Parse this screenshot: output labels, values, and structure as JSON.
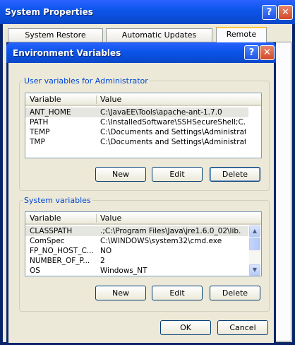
{
  "outer_window": {
    "title": "System Properties",
    "help_label": "?",
    "close_label": "✕",
    "tabs": [
      {
        "label": "System Restore"
      },
      {
        "label": "Automatic Updates"
      },
      {
        "label": "Remote"
      }
    ]
  },
  "dialog": {
    "title": "Environment Variables",
    "help_label": "?",
    "close_label": "✕",
    "user_group": {
      "label": "User variables for Administrator",
      "columns": [
        "Variable",
        "Value"
      ],
      "rows": [
        {
          "variable": "ANT_HOME",
          "value": "C:\\JavaEE\\Tools\\apache-ant-1.7.0",
          "selected": true
        },
        {
          "variable": "PATH",
          "value": "C:\\InstalledSoftware\\SSHSecureShell;C...",
          "selected": false
        },
        {
          "variable": "TEMP",
          "value": "C:\\Documents and Settings\\Administrat...",
          "selected": false
        },
        {
          "variable": "TMP",
          "value": "C:\\Documents and Settings\\Administrat...",
          "selected": false
        }
      ],
      "buttons": {
        "new": "New",
        "edit": "Edit",
        "delete": "Delete"
      }
    },
    "system_group": {
      "label": "System variables",
      "columns": [
        "Variable",
        "Value"
      ],
      "rows": [
        {
          "variable": "CLASSPATH",
          "value": ".;C:\\Program Files\\Java\\jre1.6.0_02\\lib...",
          "selected": true
        },
        {
          "variable": "ComSpec",
          "value": "C:\\WINDOWS\\system32\\cmd.exe",
          "selected": false
        },
        {
          "variable": "FP_NO_HOST_C...",
          "value": "NO",
          "selected": false
        },
        {
          "variable": "NUMBER_OF_P...",
          "value": "2",
          "selected": false
        },
        {
          "variable": "OS",
          "value": "Windows_NT",
          "selected": false
        }
      ],
      "scroll": {
        "up_label": "▲",
        "down_label": "▼"
      },
      "buttons": {
        "new": "New",
        "edit": "Edit",
        "delete": "Delete"
      }
    },
    "ok_label": "OK",
    "cancel_label": "Cancel"
  }
}
